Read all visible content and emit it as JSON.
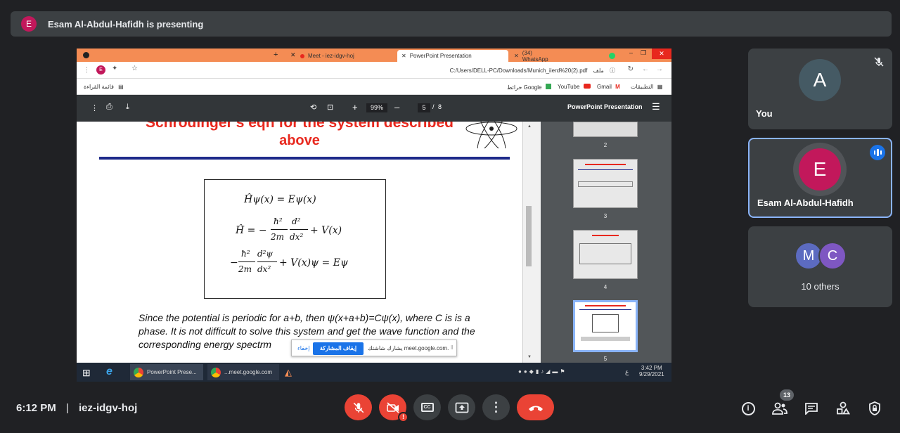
{
  "banner": {
    "avatar_letter": "E",
    "text": "Esam Al-Abdul-Hafidh is presenting"
  },
  "browser": {
    "tabs": [
      {
        "label": "Meet - iez-idgv-hoj"
      },
      {
        "label": "PowerPoint Presentation",
        "active": true
      },
      {
        "label": "(34) WhatsApp"
      }
    ],
    "profile_letter": "E",
    "url": "C:/Users/DELL-PC/Downloads/Munich_iierd%20(2).pdf",
    "url_prefix": "ملف",
    "bookmarks_right": [
      "التطبيقات",
      "Gmail",
      "YouTube",
      "خرائط Google"
    ],
    "reading_list": "قائمة القراءة"
  },
  "pdf": {
    "title": "PowerPoint Presentation",
    "zoom": "99%",
    "page_current": "5",
    "page_separator": "/",
    "page_total": "8"
  },
  "slide": {
    "title_line1": "Schrodinger's eqn for the system described",
    "title_line2": "above",
    "eq1": "Ĥψ(x) = Eψ(x)",
    "eq2_lhs": "Ĥ = −",
    "eq2_num": "ħ²",
    "eq2_den": "2m",
    "eq2_dnum": "d²",
    "eq2_dden": "dx²",
    "eq2_rhs": "+ V(x)",
    "eq3_lhs": "−",
    "eq3_num": "ħ²",
    "eq3_den": "2m",
    "eq3_dnum": "d²ψ",
    "eq3_dden": "dx²",
    "eq3_rhs": "+ V(x)ψ = Eψ",
    "body": "Since the potential is periodic for  a+b, then ψ(x+a+b)=Cψ(x), where C is is a phase. It is not difficult to solve this system and get the wave function and the corresponding energy spectrm"
  },
  "thumbnails": [
    "2",
    "3",
    "4",
    "5"
  ],
  "share_popup": {
    "text": "يشارك شاشتك meet.google.com.",
    "stop_button": "إيقاف المشاركة",
    "hide": "إخفاء"
  },
  "taskbar": {
    "items": [
      "PowerPoint Prese...",
      "...meet.google.com"
    ],
    "time": "3:42 PM",
    "date": "9/29/2021",
    "lang": "ع"
  },
  "tiles": {
    "you": {
      "letter": "A",
      "name": "You"
    },
    "presenter": {
      "letter": "E",
      "name": "Esam Al-Abdul-Hafidh"
    },
    "others": {
      "letters": [
        "M",
        "C"
      ],
      "label": "10 others"
    }
  },
  "bottom": {
    "time": "6:12 PM",
    "separator": "|",
    "meeting_code": "iez-idgv-hoj",
    "participants_badge": "13"
  },
  "colors": {
    "red": "#ea4335",
    "tile_bg": "#3c4043",
    "bg": "#202124",
    "highlight": "#8ab4f8",
    "tab_orange": "#f48c54"
  }
}
